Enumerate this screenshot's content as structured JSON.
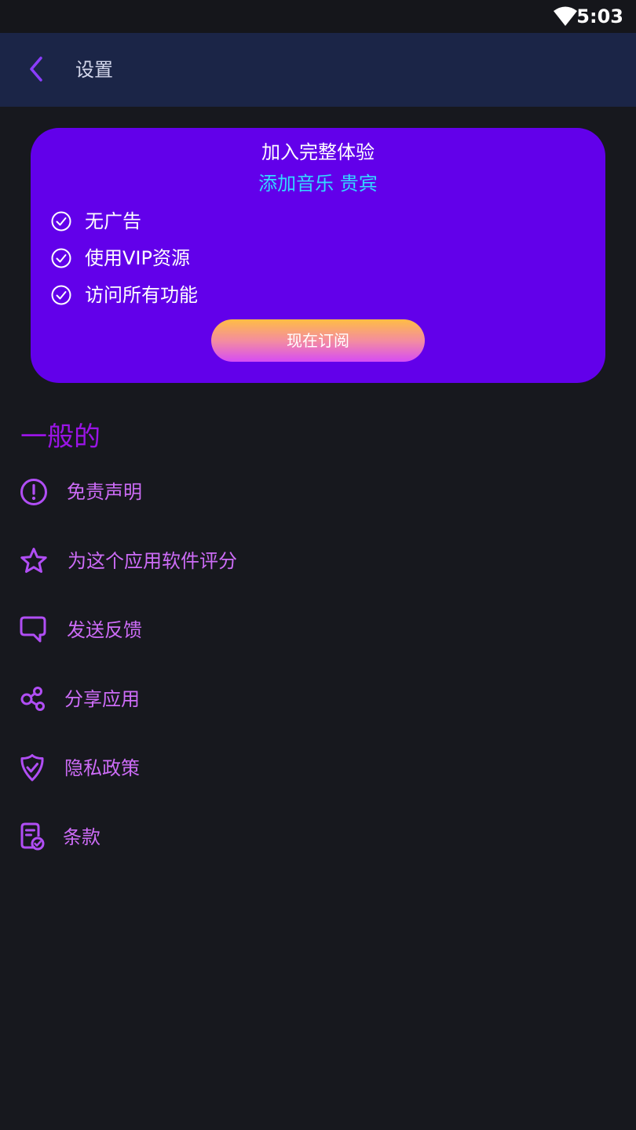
{
  "status_bar": {
    "time": "5:03"
  },
  "app_bar": {
    "title": "设置"
  },
  "promo": {
    "title": "加入完整体验",
    "subtitle": "添加音乐 贵宾",
    "features": [
      "无广告",
      "使用VIP资源",
      "访问所有功能"
    ],
    "subscribe_label": "现在订阅"
  },
  "general": {
    "section_title": "一般的",
    "items": [
      {
        "label": "免责声明",
        "icon": "alert-circle-icon"
      },
      {
        "label": "为这个应用软件评分",
        "icon": "star-icon"
      },
      {
        "label": "发送反馈",
        "icon": "chat-bubble-icon"
      },
      {
        "label": "分享应用",
        "icon": "share-icon"
      },
      {
        "label": "隐私政策",
        "icon": "shield-check-icon"
      },
      {
        "label": "条款",
        "icon": "document-check-icon"
      }
    ]
  },
  "colors": {
    "background": "#17181e",
    "app_bar": "#1b2547",
    "promo_card": "#6200ea",
    "promo_subtitle": "#33d9ff",
    "accent": "#cd6cf7",
    "section_title": "#9a14e6"
  }
}
